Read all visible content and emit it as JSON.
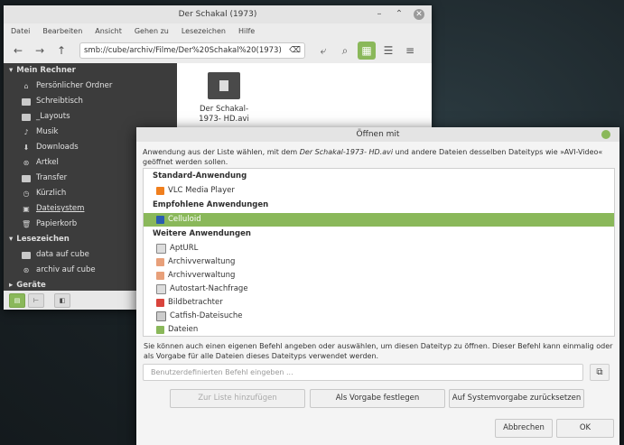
{
  "filemanager": {
    "title": "Der Schakal (1973)",
    "menu": [
      "Datei",
      "Bearbeiten",
      "Ansicht",
      "Gehen zu",
      "Lesezeichen",
      "Hilfe"
    ],
    "location": "smb://cube/archiv/Filme/Der%20Schakal%20(1973)",
    "sidebar": {
      "computer_header": "Mein Rechner",
      "computer_items": [
        "Persönlicher Ordner",
        "Schreibtisch",
        "_Layouts",
        "Musik",
        "Downloads",
        "Artkel",
        "Transfer",
        "Kürzlich",
        "Dateisystem",
        "Papierkorb"
      ],
      "bookmarks_header": "Lesezeichen",
      "bookmark_items": [
        "data auf cube",
        "archiv auf cube"
      ],
      "devices_header": "Geräte"
    },
    "file": {
      "name_line1": "Der Schakal-",
      "name_line2": "1973- HD.avi"
    }
  },
  "dialog": {
    "title": "Öffnen mit",
    "desc_pre": "Anwendung aus der Liste wählen, mit dem ",
    "desc_file": "Der Schakal-1973- HD.avi",
    "desc_post": " und andere Dateien desselben Dateityps wie »AVI-Video« geöffnet werden sollen.",
    "default_header": "Standard-Anwendung",
    "default_app": "VLC Media Player",
    "recommended_header": "Empfohlene Anwendungen",
    "recommended_app": "Celluloid",
    "other_header": "Weitere Anwendungen",
    "other_apps": [
      "AptURL",
      "Archivverwaltung",
      "Archivverwaltung",
      "Autostart-Nachfrage",
      "Bildbetrachter",
      "Catfish-Dateisuche",
      "Dateien"
    ],
    "hint": "Sie können auch einen eigenen Befehl angeben oder auswählen, um diesen Dateityp zu öffnen. Dieser Befehl kann einmalig oder als Vorgabe für alle Dateien dieses Dateityps verwendet werden.",
    "cmd_placeholder": "Benutzerdefinierten Befehl eingeben ...",
    "btn_add": "Zur Liste hinzufügen",
    "btn_default": "Als Vorgabe festlegen",
    "btn_reset": "Auf Systemvorgabe zurücksetzen",
    "btn_cancel": "Abbrechen",
    "btn_ok": "OK"
  }
}
